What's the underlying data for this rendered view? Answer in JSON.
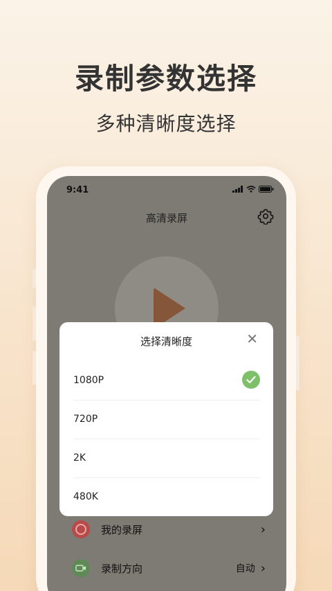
{
  "promo": {
    "headline": "录制参数选择",
    "subline": "多种清晰度选择"
  },
  "status_bar": {
    "time": "9:41"
  },
  "app": {
    "title": "高清录屏",
    "settings_icon": "gear-icon",
    "play_icon": "play-icon"
  },
  "menu": {
    "items": [
      {
        "label": "我的录屏",
        "icon": "record-icon",
        "value": ""
      },
      {
        "label": "录制方向",
        "icon": "camera-rotate-icon",
        "value": "自动"
      }
    ]
  },
  "dialog": {
    "title": "选择清晰度",
    "close_icon": "close-icon",
    "options": [
      {
        "label": "1080P",
        "selected": true
      },
      {
        "label": "720P",
        "selected": false
      },
      {
        "label": "2K",
        "selected": false
      },
      {
        "label": "480K",
        "selected": false
      }
    ]
  },
  "colors": {
    "accent_check": "#7ec06a",
    "record_red": "#b94a4a",
    "play_brown": "#85563a"
  }
}
